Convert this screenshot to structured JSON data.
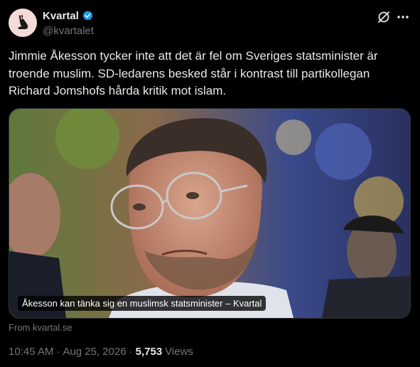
{
  "account": {
    "name": "Kvartal",
    "handle": "@kvartalet"
  },
  "tweet": {
    "text": "Jimmie Åkesson tycker inte att det är fel om Sveriges statsminister är troende muslim. SD-ledarens besked står i kontrast till partikollegan Richard Jomshofs hårda kritik mot islam."
  },
  "card": {
    "caption": "Åkesson kan tänka sig en muslimsk statsminister – Kvartal",
    "source": "From kvartal.se"
  },
  "meta": {
    "time": "10:45 AM",
    "separator": "·",
    "date": "Aug 25, 2026",
    "views_count": "5,753",
    "views_label": "Views"
  },
  "icons": {
    "avatar": "hare-icon",
    "verified": "verified-badge-icon",
    "grok": "grok-icon",
    "more": "more-icon"
  },
  "colors": {
    "background": "#000000",
    "text": "#e7e9ea",
    "secondary": "#71767b",
    "verified": "#1d9bf0",
    "avatar_bg": "#f4dad8"
  }
}
